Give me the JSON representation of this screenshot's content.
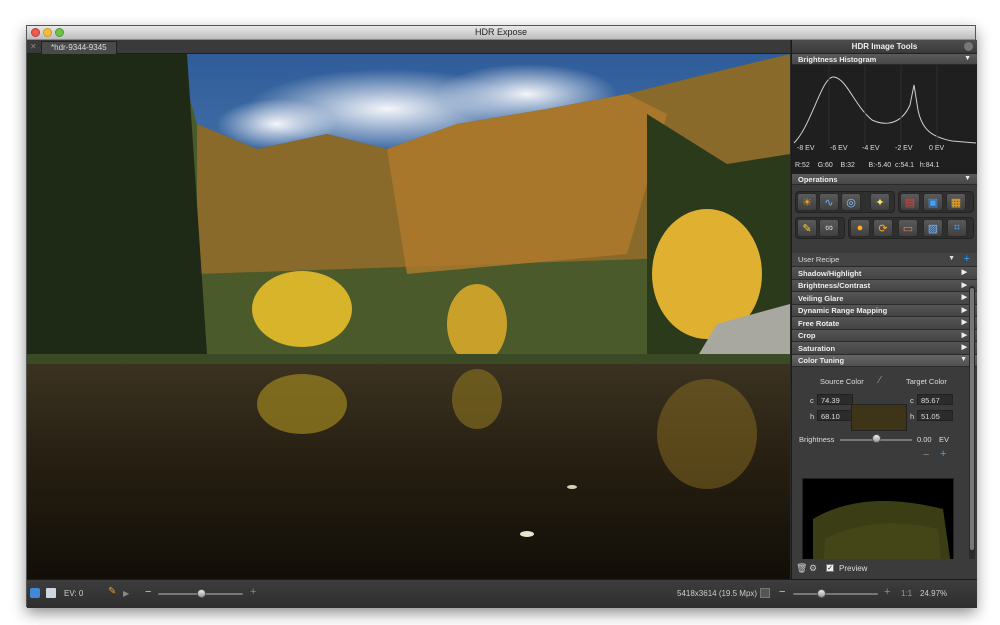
{
  "window": {
    "title": "HDR Expose"
  },
  "tab": {
    "label": "*hdr-9344-9345"
  },
  "panel": {
    "title": "HDR Image Tools",
    "histogram": {
      "header": "Brightness Histogram",
      "ticks": [
        "-8 EV",
        "-6 EV",
        "-4 EV",
        "-2 EV",
        "0 EV"
      ],
      "readout": "R:52    G:60    B:32       B:-5.40  c:54.1   h:84.1"
    },
    "operations": {
      "header": "Operations"
    },
    "recipe": {
      "label": "User Recipe"
    },
    "op_list": [
      "Shadow/Highlight",
      "Brightness/Contrast",
      "Veiling Glare",
      "Dynamic Range Mapping",
      "Free Rotate",
      "Crop",
      "Saturation",
      "Color Tuning"
    ],
    "color_tuning": {
      "source_label": "Source Color",
      "target_label": "Target Color",
      "c_label": "c",
      "h_label": "h",
      "source_c": "74.39",
      "source_h": "68.10",
      "target_c": "85.67",
      "target_h": "51.05",
      "brightness_label": "Brightness",
      "brightness_value": "0.00",
      "brightness_unit": "EV"
    },
    "preview_label": "Preview"
  },
  "bottom": {
    "ev_label": "EV: 0",
    "dimensions": "5418x3614 (19.5 Mpx)",
    "ratio": "1:1",
    "zoom": "24.97%"
  },
  "colors": {
    "accent": "#2aa7ff",
    "panel_bg": "#3b3b3b",
    "window_bg": "#2b2b2b"
  }
}
